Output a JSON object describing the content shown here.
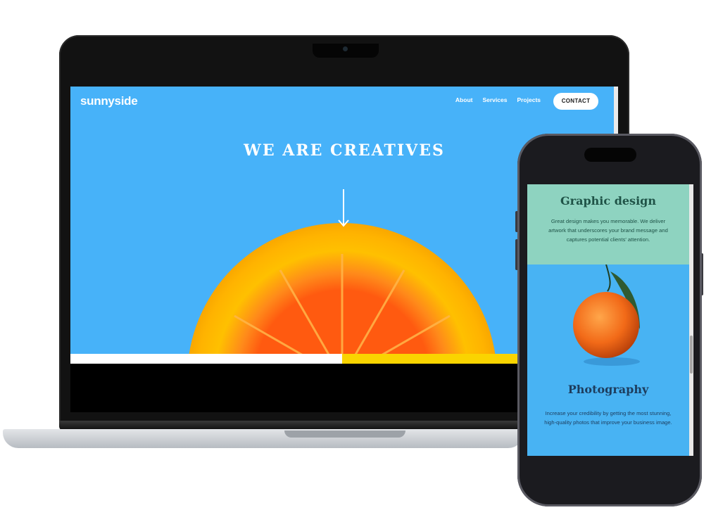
{
  "laptop": {
    "brand": "sunnyside",
    "nav": [
      "About",
      "Services",
      "Projects"
    ],
    "contact_label": "CONTACT",
    "hero_title": "WE ARE CREATIVES"
  },
  "phone": {
    "graphic_design_title": "Graphic design",
    "graphic_design_text": "Great design makes you memorable. We deliver artwork that underscores your brand message and captures potential clients' attention.",
    "photography_title": "Photography",
    "photography_text": "Increase your credibility by getting the most stunning, high-quality photos that improve your business image."
  },
  "colors": {
    "hero_blue": "#47b2f9",
    "accent_yellow": "#fad400",
    "graphic_design_bg": "#8ed3c0",
    "photography_bg": "#48b3f3"
  }
}
